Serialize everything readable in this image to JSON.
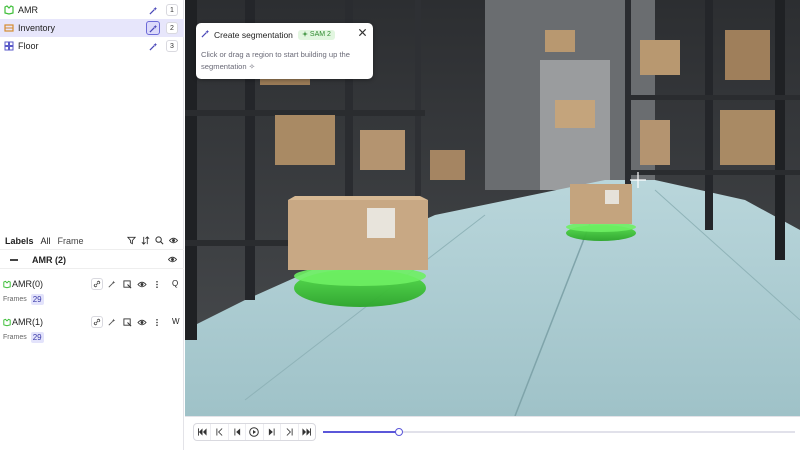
{
  "classes": [
    {
      "name": "AMR",
      "key": "1",
      "selected": false
    },
    {
      "name": "Inventory",
      "key": "2",
      "selected": true
    },
    {
      "name": "Floor",
      "key": "3",
      "selected": false
    }
  ],
  "labels_panel": {
    "title": "Labels",
    "filter_all": "All",
    "filter_frame": "Frame",
    "group": {
      "name": "AMR (2)"
    },
    "objects": [
      {
        "name": "AMR(0)",
        "key": "Q",
        "frames_label": "Frames",
        "frames_count": "29"
      },
      {
        "name": "AMR(1)",
        "key": "W",
        "frames_label": "Frames",
        "frames_count": "29"
      }
    ]
  },
  "popup": {
    "title": "Create segmentation",
    "badge": "SAM 2",
    "body": "Click or drag a region to start building up the segmentation ✧"
  },
  "playback": {
    "progress": 0.16
  },
  "colors": {
    "accent": "#5b57d9",
    "mask_green": "#3fd23a",
    "selected_bg": "#e7e6fb"
  }
}
